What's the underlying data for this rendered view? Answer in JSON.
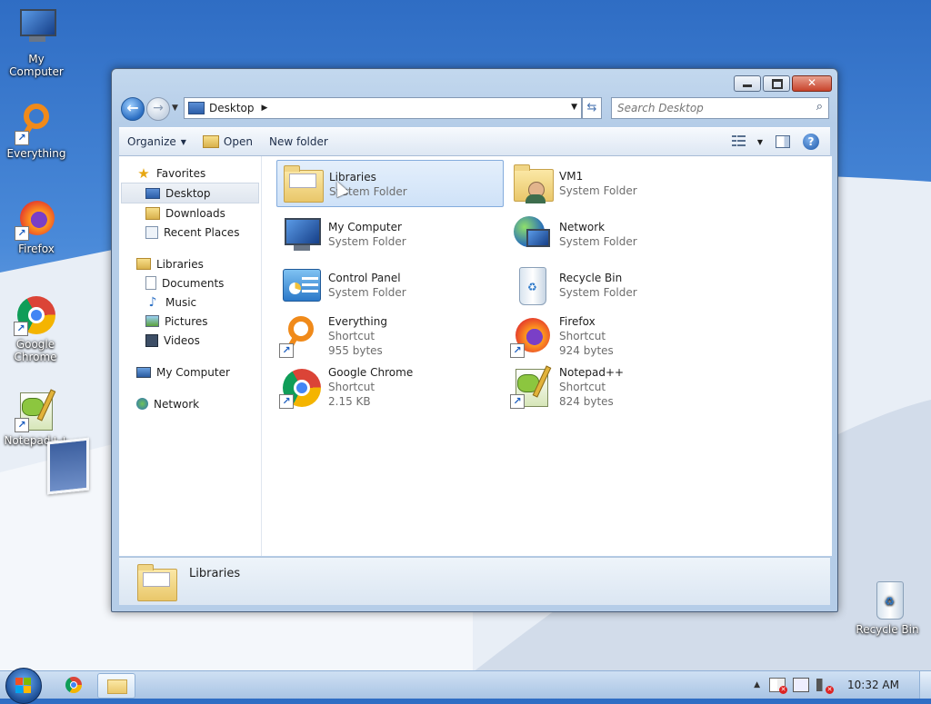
{
  "desktop": {
    "icons": [
      {
        "label": "My Computer",
        "icon": "my-computer-icon"
      },
      {
        "label": "Everything",
        "icon": "everything-icon"
      },
      {
        "label": "Firefox",
        "icon": "firefox-icon"
      },
      {
        "label": "Google Chrome",
        "icon": "chrome-icon"
      },
      {
        "label": "Notepad++",
        "icon": "notepadpp-icon"
      },
      {
        "label": "Recycle Bin",
        "icon": "recycle-bin-icon"
      }
    ]
  },
  "window": {
    "breadcrumb": "Desktop",
    "search_placeholder": "Search Desktop",
    "toolbar": {
      "organize": "Organize",
      "open": "Open",
      "new_folder": "New folder"
    },
    "nav": {
      "favorites": "Favorites",
      "favorites_items": [
        "Desktop",
        "Downloads",
        "Recent Places"
      ],
      "libraries": "Libraries",
      "libraries_items": [
        "Documents",
        "Music",
        "Pictures",
        "Videos"
      ],
      "my_computer": "My Computer",
      "network": "Network"
    },
    "items": [
      {
        "name": "Libraries",
        "type": "System Folder",
        "size": ""
      },
      {
        "name": "VM1",
        "type": "System Folder",
        "size": ""
      },
      {
        "name": "My Computer",
        "type": "System Folder",
        "size": ""
      },
      {
        "name": "Network",
        "type": "System Folder",
        "size": ""
      },
      {
        "name": "Control Panel",
        "type": "System Folder",
        "size": ""
      },
      {
        "name": "Recycle Bin",
        "type": "System Folder",
        "size": ""
      },
      {
        "name": "Everything",
        "type": "Shortcut",
        "size": "955 bytes"
      },
      {
        "name": "Firefox",
        "type": "Shortcut",
        "size": "924 bytes"
      },
      {
        "name": "Google Chrome",
        "type": "Shortcut",
        "size": "2.15 KB"
      },
      {
        "name": "Notepad++",
        "type": "Shortcut",
        "size": "824 bytes"
      }
    ],
    "details_pane": {
      "name": "Libraries"
    }
  },
  "taskbar": {
    "clock": "10:32 AM"
  },
  "colors": {
    "selection": "#cfe2f8",
    "accent": "#2b6ec2"
  }
}
